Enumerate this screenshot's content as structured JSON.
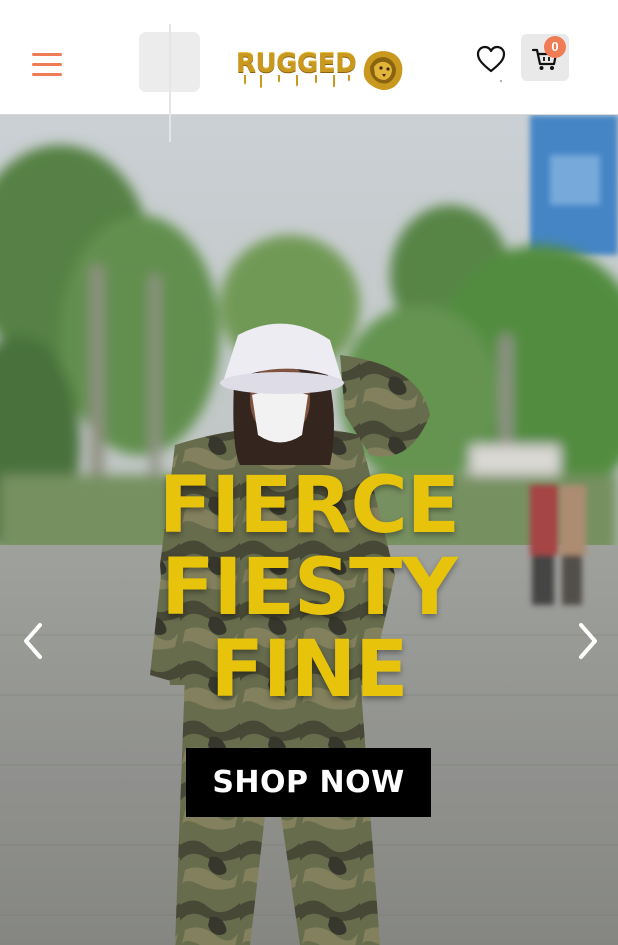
{
  "header": {
    "logo_text": "RUGGED",
    "cart_count": "0"
  },
  "hero": {
    "headline": [
      "FIERCE",
      "FIESTY",
      "FINE"
    ],
    "cta_label": "SHOP NOW"
  },
  "colors": {
    "accent": "#f07c55",
    "headline": "#e8c30b",
    "logo_gold": "#c9981e",
    "cta_bg": "#000000"
  },
  "icons": {
    "menu": "hamburger-menu-icon",
    "wishlist": "heart-icon",
    "cart": "cart-icon",
    "prev": "chevron-left-icon",
    "next": "chevron-right-icon",
    "logo_mark": "lion-head-icon"
  }
}
